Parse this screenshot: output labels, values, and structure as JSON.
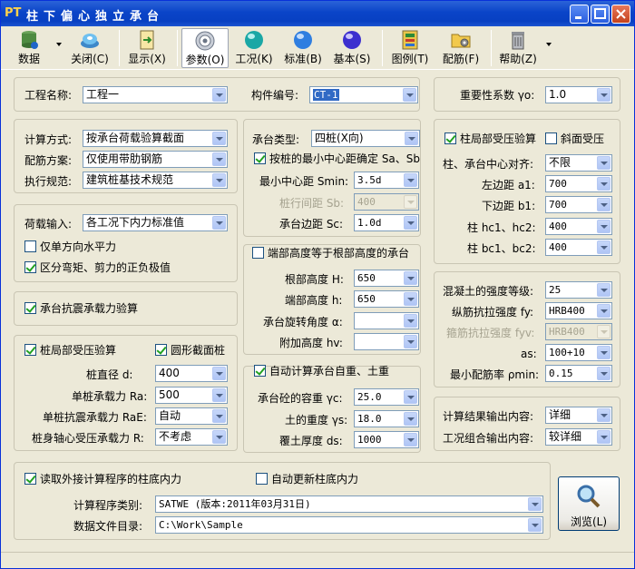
{
  "window": {
    "logo": "PT",
    "title": "柱下偏心独立承台"
  },
  "toolbar": {
    "data": "数据",
    "close": "关闭(C)",
    "display": "显示(X)",
    "params": "参数(O)",
    "case": "工况(K)",
    "standard": "标准(B)",
    "basic": "基本(S)",
    "legend": "图例(T)",
    "rebar": "配筋(F)",
    "help": "帮助(Z)"
  },
  "project": {
    "label": "工程名称:",
    "value": "工程一"
  },
  "member": {
    "label": "构件编号:",
    "value": "CT-1"
  },
  "importance": {
    "label": "重要性系数 γo:",
    "value": "1.0"
  },
  "calc": {
    "method_label": "计算方式:",
    "method": "按承台荷载验算截面",
    "rebar_label": "配筋方案:",
    "rebar": "仅使用带肋钢筋",
    "code_label": "执行规范:",
    "code": "建筑桩基技术规范"
  },
  "load": {
    "input_label": "荷载输入:",
    "input": "各工况下内力标准值",
    "horiz": "仅单方向水平力",
    "signs": "区分弯矩、剪力的正负极值"
  },
  "seismic": {
    "label": "承台抗震承载力验算"
  },
  "pile": {
    "local": "桩局部受压验算",
    "round": "圆形截面桩",
    "diam_label": "桩直径 d:",
    "diam": "400",
    "ra_label": "单桩承载力 Ra:",
    "ra": "500",
    "rae_label": "单桩抗震承载力 RaE:",
    "rae": "自动",
    "r_label": "桩身轴心受压承载力 R:",
    "r": "不考虑"
  },
  "cap": {
    "type_label": "承台类型:",
    "type": "四桩(X向)",
    "minspacing": "按桩的最小中心距确定 Sa、Sb",
    "smin_label": "最小中心距 Smin:",
    "smin": "3.5d",
    "sb_label": "桩行间距 Sb:",
    "sb": "400",
    "sc_label": "承台边距 Sc:",
    "sc": "1.0d"
  },
  "height": {
    "equal": "端部高度等于根部高度的承台",
    "h_root_label": "根部高度 H:",
    "h_root": "650",
    "h_end_label": "端部高度 h:",
    "h_end": "650",
    "angle_label": "承台旋转角度 α:",
    "angle": "",
    "hv_label": "附加高度 hv:",
    "hv": ""
  },
  "weight": {
    "auto": "自动计算承台自重、土重",
    "yc_label": "承台砼的容重 γc:",
    "yc": "25.0",
    "ys_label": "土的重度 γs:",
    "ys": "18.0",
    "ds_label": "覆土厚度 ds:",
    "ds": "1000"
  },
  "column": {
    "local": "柱局部受压验算",
    "slope": "斜面受压",
    "align_label": "柱、承台中心对齐:",
    "align": "不限",
    "a1_label": "左边距 a1:",
    "a1": "700",
    "b1_label": "下边距 b1:",
    "b1": "700",
    "hc_label": "柱 hc1、hc2:",
    "hc": "400",
    "bc_label": "柱 bc1、bc2:",
    "bc": "400"
  },
  "material": {
    "conc_label": "混凝土的强度等级:",
    "conc": "25",
    "fy_label": "纵筋抗拉强度 fy:",
    "fy": "HRB400",
    "fyv_label": "箍筋抗拉强度 fyv:",
    "fyv": "HRB400",
    "as_label": "as:",
    "as": "100+10",
    "pmin_label": "最小配筋率 ρmin:",
    "pmin": "0.15"
  },
  "output": {
    "result_label": "计算结果输出内容:",
    "result": "详细",
    "combo_label": "工况组合输出内容:",
    "combo": "较详细"
  },
  "external": {
    "read": "读取外接计算程序的柱底内力",
    "auto": "自动更新柱底内力",
    "program_label": "计算程序类别:",
    "program": "SATWE (版本:2011年03月31日)",
    "dir_label": "数据文件目录:",
    "dir": "C:\\Work\\Sample"
  },
  "browse": {
    "label": "浏览(L)"
  },
  "colors": {
    "titlebar": "#0a44c8",
    "face": "#ece9d8",
    "border": "#7f9db9",
    "selection": "#316ac5"
  }
}
